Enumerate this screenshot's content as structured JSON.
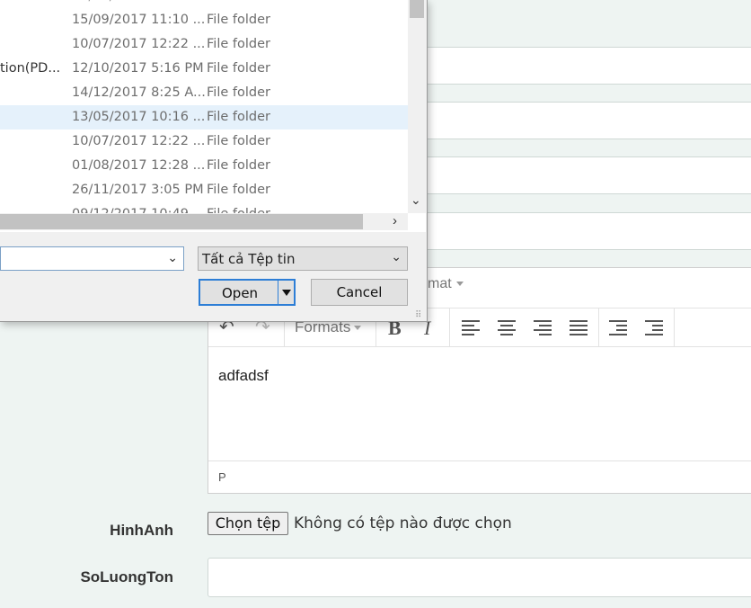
{
  "dialog": {
    "files": [
      {
        "name": "",
        "date": "15/09/2017 11:10 ...",
        "type": "File folder",
        "selected": false
      },
      {
        "name": "",
        "date": "10/07/2017 12:22 ...",
        "type": "File folder",
        "selected": false
      },
      {
        "name": "tion(PD...",
        "date": "12/10/2017 5:16 PM",
        "type": "File folder",
        "selected": false
      },
      {
        "name": "",
        "date": "14/12/2017 8:25 A...",
        "type": "File folder",
        "selected": false
      },
      {
        "name": "",
        "date": "13/05/2017 10:16 ...",
        "type": "File folder",
        "selected": true
      },
      {
        "name": "",
        "date": "10/07/2017 12:22 ...",
        "type": "File folder",
        "selected": false
      },
      {
        "name": "",
        "date": "01/08/2017 12:28 ...",
        "type": "File folder",
        "selected": false
      },
      {
        "name": "",
        "date": "26/11/2017 3:05 PM",
        "type": "File folder",
        "selected": false
      }
    ],
    "filetype": "Tất cả Tệp tin",
    "open_label": "Open",
    "cancel_label": "Cancel"
  },
  "editor": {
    "menubar_fragment": "mat",
    "formats_label": "Formats",
    "content": "adfadsf",
    "status_path": "P"
  },
  "form": {
    "hinhanh_label": "HinhAnh",
    "choose_file_label": "Chọn tệp",
    "no_file_text": "Không có tệp nào được chọn",
    "soluongton_label": "SoLuongTon"
  },
  "colors": {
    "page_bg": "#eef4f2",
    "selected_row": "#e5f1fb",
    "accent": "#2d7ed6"
  }
}
